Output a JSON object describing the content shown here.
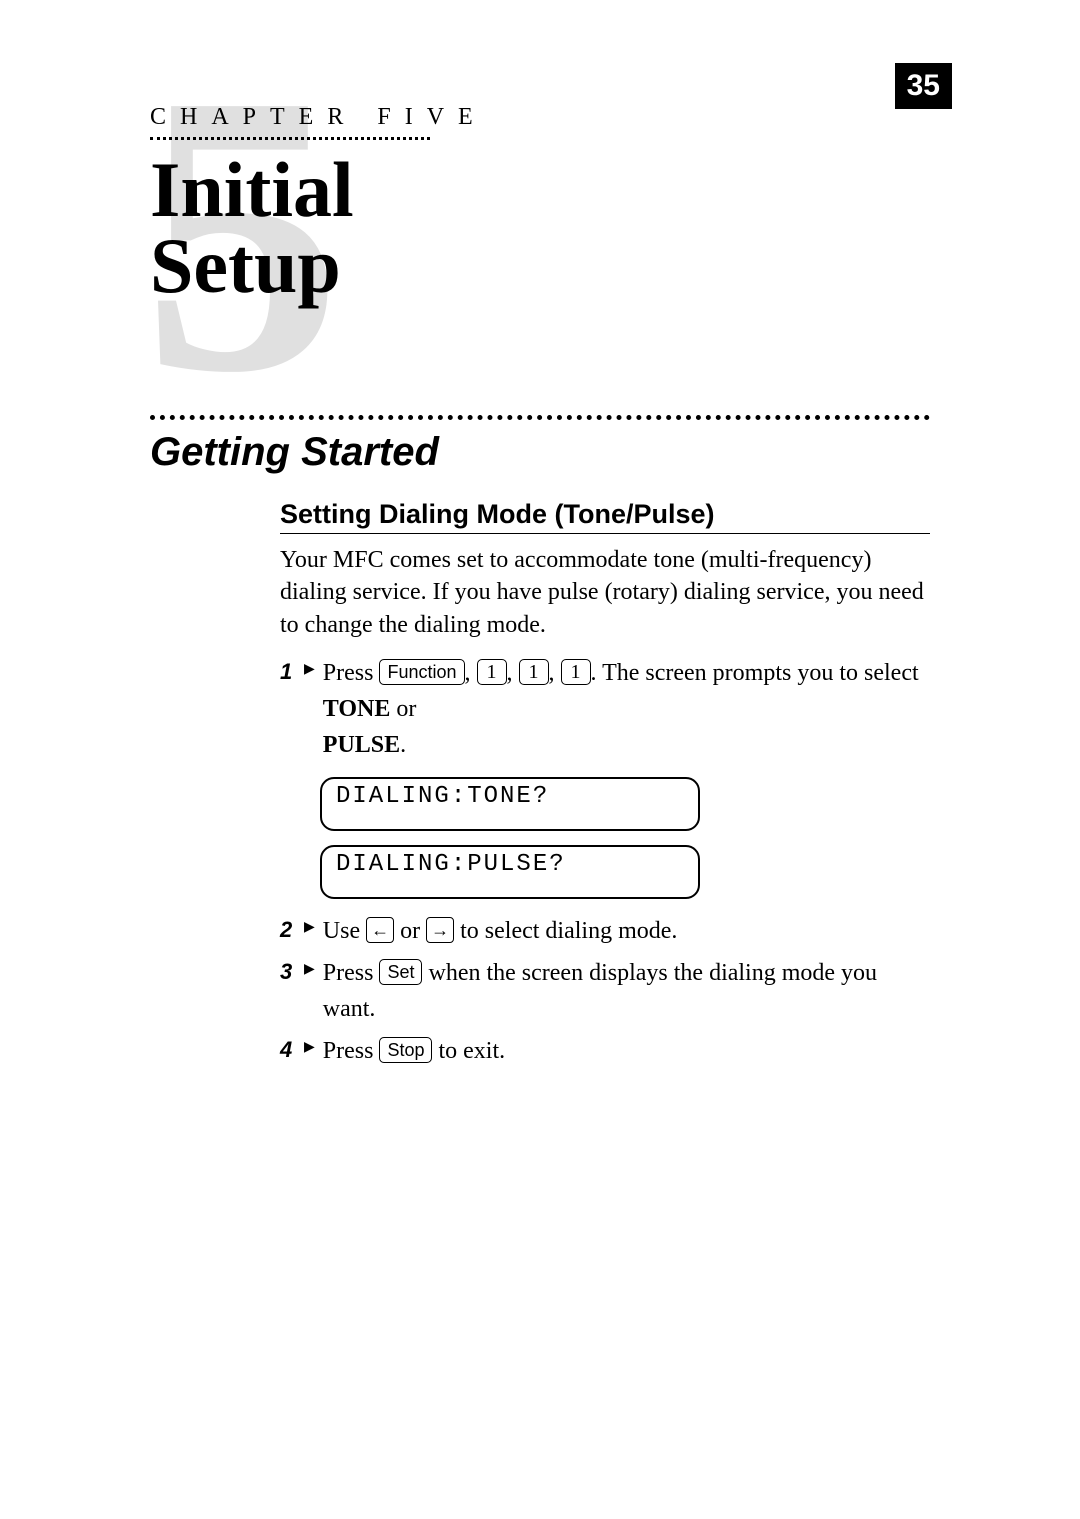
{
  "page_number": "35",
  "chapter": {
    "big_number": "5",
    "label": "CHAPTER FIVE",
    "title_line1": "Initial",
    "title_line2": "Setup"
  },
  "section": {
    "title": "Getting Started",
    "subsection": {
      "title": "Setting Dialing Mode (Tone/Pulse)",
      "intro": "Your MFC comes set to accommodate tone (multi-frequency) dialing service. If you have pulse (rotary) dialing service, you need to change the dialing mode.",
      "steps": [
        {
          "num": "1",
          "pre": "Press ",
          "key_fn": "Function",
          "sep": ", ",
          "key_1": "1",
          "mid": ". The screen prompts you to select ",
          "bold1": "TONE",
          "or": " or ",
          "bold2": "PULSE",
          "end": "."
        },
        {
          "num": "2",
          "pre": "Use ",
          "arrow_left": "←",
          "or": " or ",
          "arrow_right": "→",
          "post": " to select dialing mode."
        },
        {
          "num": "3",
          "pre": "Press ",
          "key": "Set",
          "post": " when the screen displays the dialing mode you want."
        },
        {
          "num": "4",
          "pre": "Press ",
          "key": "Stop",
          "post": " to exit."
        }
      ],
      "lcd1": "DIALING:TONE?",
      "lcd2": "DIALING:PULSE?"
    }
  }
}
